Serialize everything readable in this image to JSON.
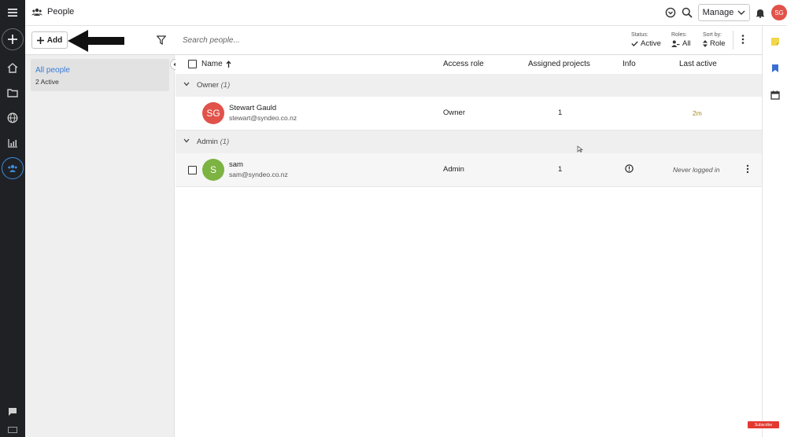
{
  "app": {
    "page_title": "People"
  },
  "topbar": {
    "manage_label": "Manage",
    "user_initials": "SG"
  },
  "toolbar": {
    "add_label": "Add",
    "search_placeholder": "Search people...",
    "status_label": "Status:",
    "status_value": "Active",
    "roles_label": "Roles:",
    "roles_value": "All",
    "sort_label": "Sort by:",
    "sort_value": "Role"
  },
  "leftpanel": {
    "filter_title": "All people",
    "filter_sub": "2 Active"
  },
  "table": {
    "columns": {
      "name": "Name",
      "access_role": "Access role",
      "assigned_projects": "Assigned projects",
      "info": "Info",
      "last_active": "Last active"
    },
    "groups": [
      {
        "label": "Owner",
        "count": "(1)",
        "rows": [
          {
            "initials": "SG",
            "name": "Stewart Gauld",
            "email": "stewart@syndeo.co.nz",
            "access_role": "Owner",
            "projects": "1",
            "last_active": "2m",
            "avatar_color": "#e0524a"
          }
        ]
      },
      {
        "label": "Admin",
        "count": "(1)",
        "rows": [
          {
            "initials": "S",
            "name": "sam",
            "email": "sam@syndeo.co.nz",
            "access_role": "Admin",
            "projects": "1",
            "last_active": "Never logged in",
            "avatar_color": "#7cb342"
          }
        ]
      }
    ]
  },
  "colors": {
    "rail_bg": "#1f2125",
    "accent_blue": "#3a7bd5",
    "avatar_red": "#e0524a",
    "avatar_green": "#7cb342",
    "last_active_gold": "#a8861f"
  },
  "badge": {
    "label": "Subscribe"
  }
}
